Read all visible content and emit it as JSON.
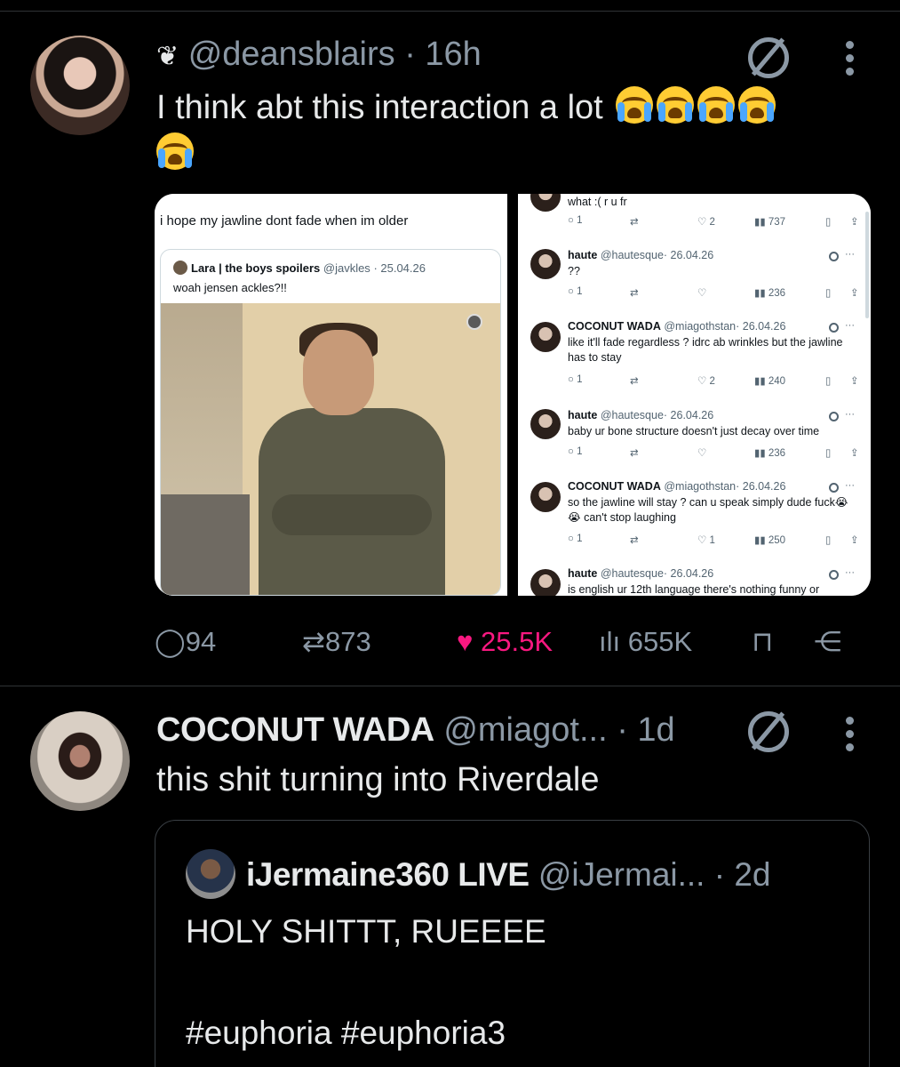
{
  "tweet1": {
    "badge_icon": "bow-icon",
    "handle": "@deansblairs",
    "separator": "·",
    "time": "16h",
    "text": "I think abt this interaction a lot",
    "emoji_count": 5,
    "media": {
      "left_caption": "i hope my jawline dont fade when im older",
      "quoted_name": "Lara | the boys spoilers",
      "quoted_handle": "@javkles",
      "quoted_date": "· 25.04.26",
      "quoted_text": "woah jensen ackles?!!",
      "replies": [
        {
          "name": "",
          "handle": "",
          "date": "",
          "text": "what :( r u fr",
          "actions": {
            "reply": "1",
            "like": "2",
            "views": "737"
          }
        },
        {
          "name": "haute",
          "handle": "@hautesque",
          "date": "· 26.04.26",
          "text": "??",
          "actions": {
            "reply": "1",
            "like": "",
            "views": "236"
          }
        },
        {
          "name": "COCONUT WADA",
          "handle": "@miagothstan",
          "date": "· 26.04.26",
          "text": "like it'll fade regardless ? idrc ab wrinkles but the jawline has to stay",
          "actions": {
            "reply": "1",
            "like": "2",
            "views": "240"
          }
        },
        {
          "name": "haute",
          "handle": "@hautesque",
          "date": "· 26.04.26",
          "text": "baby ur bone structure doesn't just decay over time",
          "actions": {
            "reply": "1",
            "like": "",
            "views": "236"
          }
        },
        {
          "name": "COCONUT WADA",
          "handle": "@miagothstan",
          "date": "· 26.04.26",
          "text": "so the jawline will stay ? can u speak simply dude fuck😭😭 can't stop laughing",
          "actions": {
            "reply": "1",
            "like": "1",
            "views": "250"
          }
        },
        {
          "name": "haute",
          "handle": "@hautesque",
          "date": "· 26.04.26",
          "text": "is english ur 12th language there's nothing funny or",
          "actions": {
            "reply": "",
            "like": "",
            "views": ""
          }
        }
      ]
    },
    "actions": {
      "replies": "94",
      "reposts": "873",
      "likes": "25.5K",
      "views": "655K"
    }
  },
  "tweet2": {
    "name": "COCONUT WADA",
    "handle": "@miagot...",
    "separator": "·",
    "time": "1d",
    "text": "this shit turning into Riverdale",
    "quote": {
      "name": "iJermaine360 LIVE",
      "handle": "@iJermai...",
      "separator": "·",
      "time": "2d",
      "line1": "HOLY SHITTT, RUEEEE",
      "line2": "#euphoria #euphoria3"
    }
  },
  "colors": {
    "background": "#000000",
    "text": "#e7e9ea",
    "muted": "#8b98a5",
    "like_active": "#f91880",
    "divider": "#2f3336"
  }
}
